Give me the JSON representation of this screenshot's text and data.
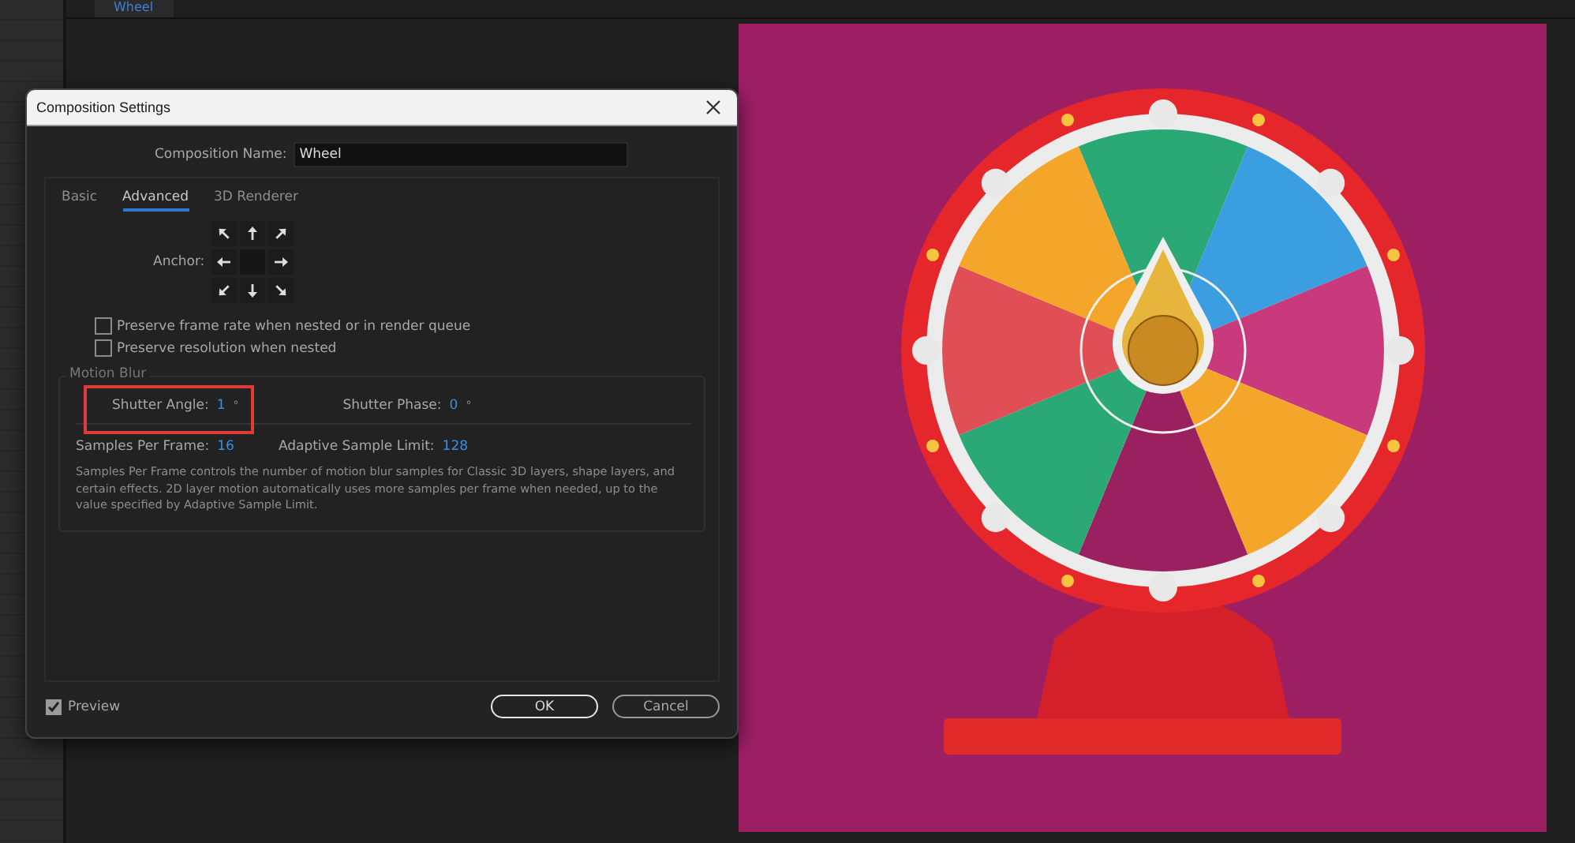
{
  "app": {
    "tab": "Wheel"
  },
  "dialog": {
    "title": "Composition Settings",
    "name_label": "Composition Name:",
    "name_value": "Wheel",
    "tabs": [
      {
        "label": "Basic",
        "selected": false
      },
      {
        "label": "Advanced",
        "selected": true
      },
      {
        "label": "3D Renderer",
        "selected": false
      }
    ],
    "anchor_label": "Anchor:",
    "checkboxes": [
      {
        "label": "Preserve frame rate when nested or in render queue",
        "checked": false
      },
      {
        "label": "Preserve resolution when nested",
        "checked": false
      }
    ],
    "motion_blur": {
      "title": "Motion Blur",
      "fields": [
        {
          "label": "Shutter Angle:",
          "value": "1",
          "unit": "°",
          "highlighted": true
        },
        {
          "label": "Shutter Phase:",
          "value": "0",
          "unit": "°",
          "highlighted": false
        }
      ],
      "samples": [
        {
          "label": "Samples Per Frame:",
          "value": "16"
        },
        {
          "label": "Adaptive Sample Limit:",
          "value": "128"
        }
      ],
      "note": "Samples Per Frame controls the number of motion blur samples for Classic 3D layers, shape layers, and certain effects. 2D layer motion automatically uses more samples per frame when needed, up to the value specified by Adaptive Sample Limit."
    },
    "preview": {
      "label": "Preview",
      "checked": true
    },
    "buttons": [
      {
        "label": "OK",
        "kind": "primary"
      },
      {
        "label": "Cancel",
        "kind": "secondary"
      }
    ]
  }
}
